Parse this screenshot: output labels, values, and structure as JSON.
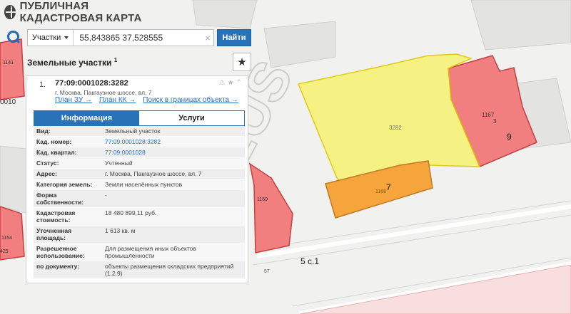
{
  "app": {
    "title": "ПУБЛИЧНАЯ КАДАСТРОВАЯ КАРТА"
  },
  "search": {
    "type_label": "Участки",
    "value": "55,843865 37,528555",
    "find_label": "Найти"
  },
  "results": {
    "title": "Земельные участки",
    "count": "1"
  },
  "card": {
    "number": "1.",
    "cad_id": "77:09:0001028:3282",
    "address": "г. Москва, Пакгаузное шоссе, вл. 7",
    "links": [
      "План ЗУ →",
      "План КК →",
      "Поиск в границах объекта →"
    ],
    "tabs": [
      "Информация",
      "Услуги"
    ],
    "fields": [
      {
        "k": "Вид:",
        "v": "Земельный участок"
      },
      {
        "k": "Кад. номер:",
        "v": "77:09:0001028:3282",
        "link": true
      },
      {
        "k": "Кад. квартал:",
        "v": "77:09:0001028",
        "link": true
      },
      {
        "k": "Статус:",
        "v": "Учтенный"
      },
      {
        "k": "Адрес:",
        "v": "г. Москва, Пакгаузное шоссе, вл. 7"
      },
      {
        "k": "Категория земель:",
        "v": "Земли населённых пунктов"
      },
      {
        "k": "Форма собственности:",
        "v": "-"
      },
      {
        "k": "Кадастровая стоимость:",
        "v": "18 480 899,11 руб."
      },
      {
        "k": "Уточненная площадь:",
        "v": "1 613 кв. м"
      },
      {
        "k": "Разрешенное использование:",
        "v": "Для размещения иных объектов промышленности"
      },
      {
        "k": "по документу:",
        "v": "объекты размещения складских предприятий (1.2.9)"
      }
    ]
  },
  "map": {
    "labels": {
      "parcel_id": "3282",
      "building_1167": "1167",
      "building_1167_sub": "3",
      "building_9": "9",
      "building_7_num": "1168",
      "building_7": "7",
      "label_1169": "1169",
      "label_1154": "1154",
      "label_425": "425",
      "label_1141": "1141",
      "label_0010": "0010",
      "label_5c1": "5 с.1",
      "label_57": "57"
    },
    "watermark": "TELUS",
    "colors": {
      "parcel_fill": "#f7f17a",
      "parcel_stroke": "#e0c800",
      "building_fill": "#f27f7f",
      "building_stroke": "#c24040",
      "orange_fill": "#f5a53c",
      "road": "#f6d0d0"
    }
  }
}
